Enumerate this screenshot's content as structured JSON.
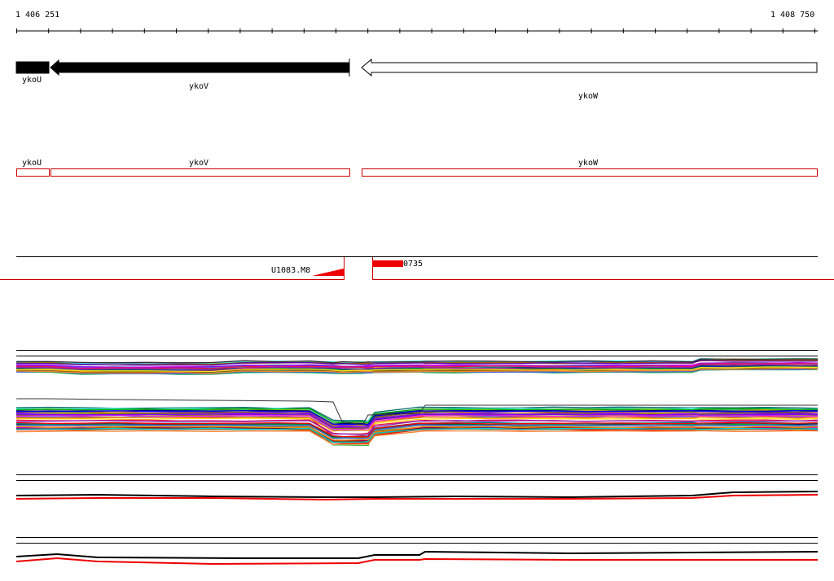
{
  "ruler": {
    "start_label": "1 406 251",
    "end_label": "1 408 750"
  },
  "genes": [
    {
      "name": "ykoU",
      "strand": "minus",
      "fill": "#000000"
    },
    {
      "name": "ykoV",
      "strand": "minus",
      "fill": "#000000"
    },
    {
      "name": "ykoW",
      "strand": "minus",
      "fill": "#ffffff"
    }
  ],
  "annotations": [
    {
      "name": "ykoU"
    },
    {
      "name": "ykoV"
    },
    {
      "name": "ykoW"
    }
  ],
  "features": {
    "left_label": "U1083.M8",
    "right_label": "0735"
  },
  "colors": {
    "feature_outline": "#cc0000",
    "feature_fill": "#ee0000",
    "axis": "#000000"
  }
}
